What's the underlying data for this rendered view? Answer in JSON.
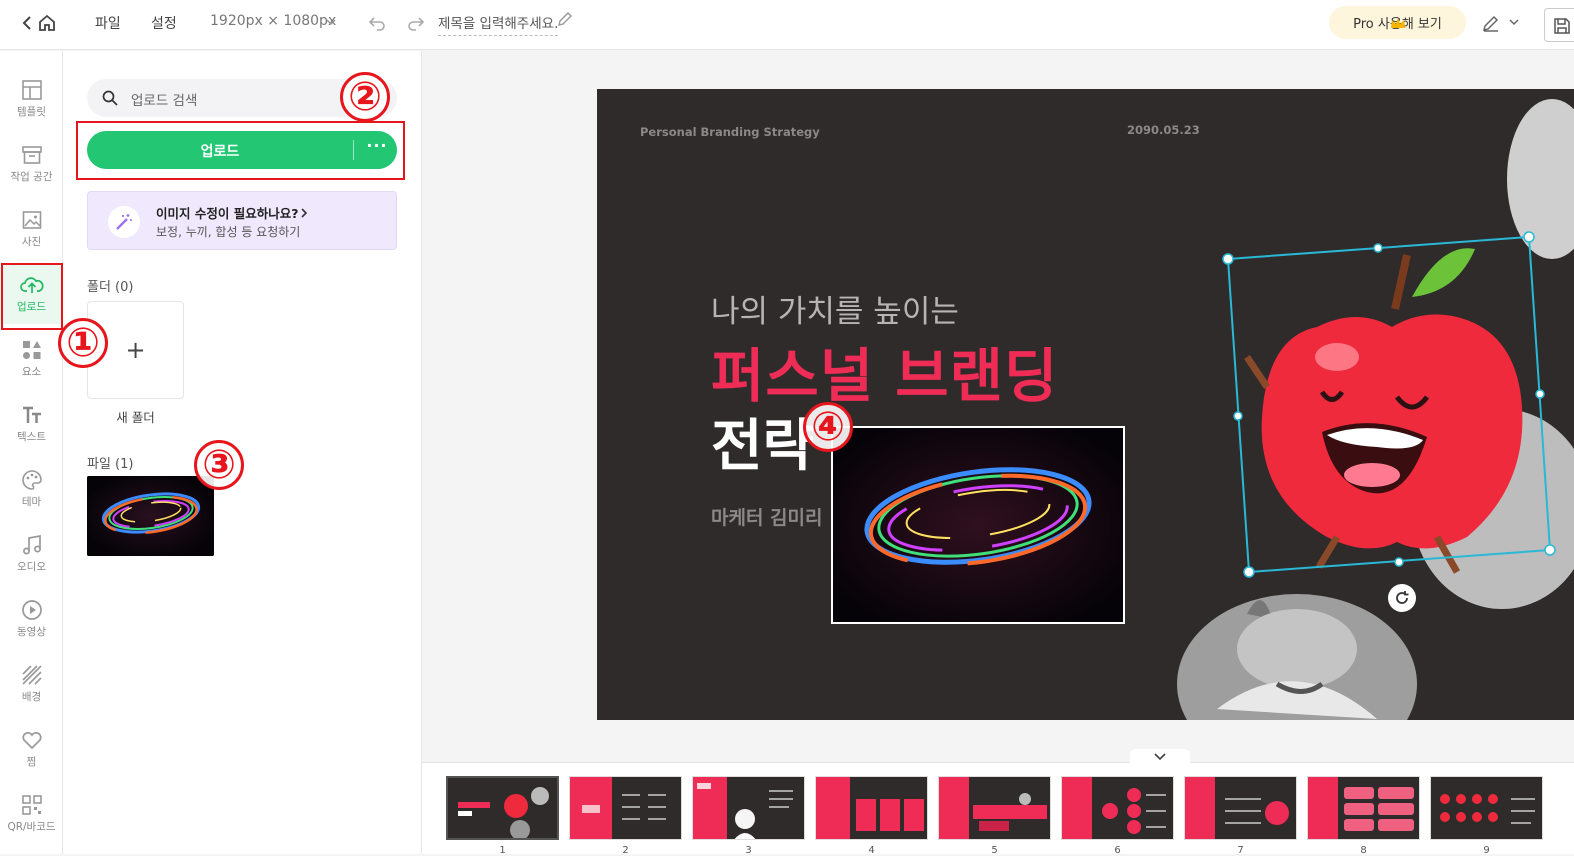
{
  "topbar": {
    "menu_file": "파일",
    "menu_settings": "설정",
    "canvas_size": "1920px × 1080px",
    "title_placeholder": "제목을 입력해주세요.",
    "pro_label": "Pro 사용해 보기"
  },
  "leftnav": {
    "items": [
      {
        "label": "템플릿",
        "icon": "template-icon"
      },
      {
        "label": "작업 공간",
        "icon": "workspace-icon"
      },
      {
        "label": "사진",
        "icon": "photo-icon"
      },
      {
        "label": "업로드",
        "icon": "upload-cloud-icon",
        "active": true
      },
      {
        "label": "요소",
        "icon": "elements-icon"
      },
      {
        "label": "텍스트",
        "icon": "text-icon"
      },
      {
        "label": "테마",
        "icon": "palette-icon"
      },
      {
        "label": "오디오",
        "icon": "music-icon"
      },
      {
        "label": "동영상",
        "icon": "video-icon"
      },
      {
        "label": "배경",
        "icon": "background-icon"
      },
      {
        "label": "찜",
        "icon": "heart-icon"
      },
      {
        "label": "QR/바코드",
        "icon": "qr-icon"
      }
    ]
  },
  "panel": {
    "search_placeholder": "업로드 검색",
    "upload_label": "업로드",
    "upload_more": "···",
    "edit_title": "이미지 수정이 필요하나요?",
    "edit_subtitle": "보정, 누끼, 합성 등 요청하기",
    "folder_section": "폴더 (0)",
    "new_folder_plus": "+",
    "new_folder_label": "새 폴더",
    "file_section": "파일 (1)"
  },
  "slide": {
    "brand": "Personal Branding Strategy",
    "date": "2090.05.23",
    "line1": "나의 가치를 높이는",
    "line2": "퍼스널 브랜딩",
    "line3": "전략",
    "line4": "마케터 김미리"
  },
  "annotations": {
    "m1": "①",
    "m2": "②",
    "m3": "③",
    "m4": "④"
  },
  "filmstrip": {
    "numbers": [
      "1",
      "2",
      "3",
      "4",
      "5",
      "6",
      "7",
      "8",
      "9"
    ]
  },
  "colors": {
    "brand_green": "#22c673",
    "slide_bg": "#2f2b2b",
    "accent_red": "#ee2c56",
    "selection_cyan": "#29b8d6",
    "annotation_red": "#e6161c"
  }
}
